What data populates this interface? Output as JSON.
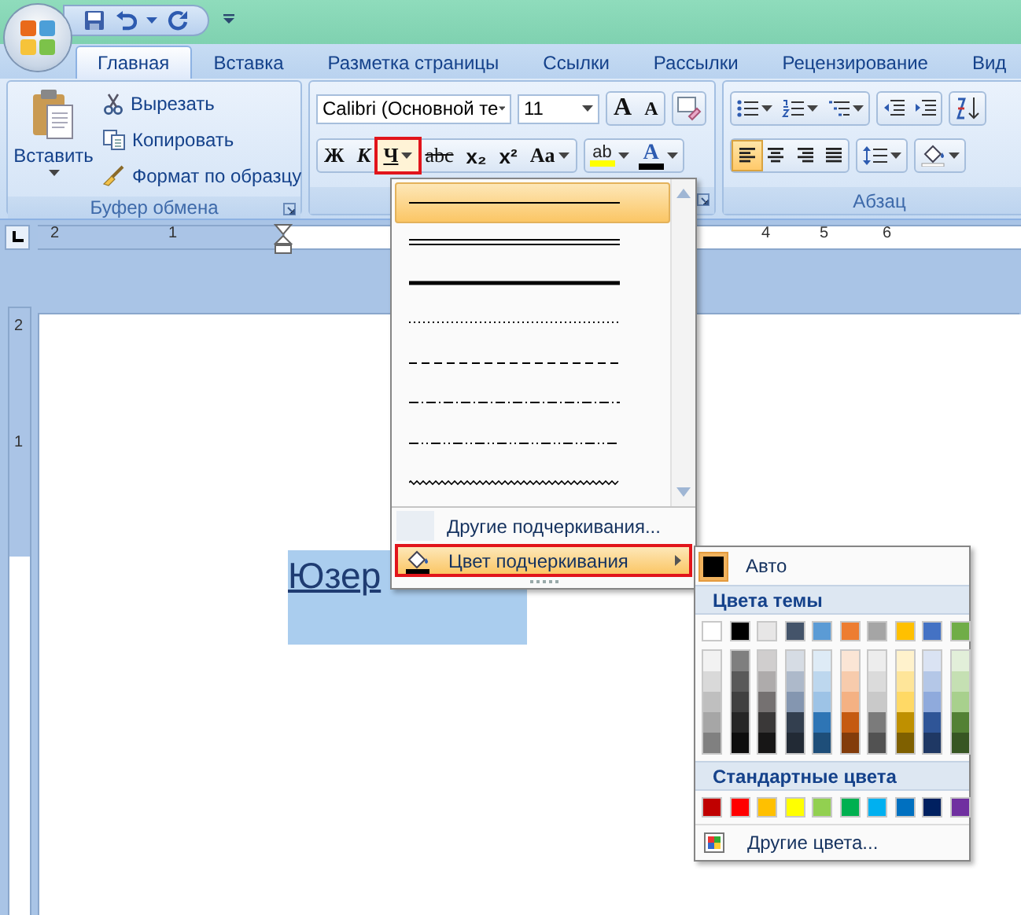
{
  "tabs": [
    {
      "label": "Главная",
      "selected": true
    },
    {
      "label": "Вставка",
      "selected": false
    },
    {
      "label": "Разметка страницы",
      "selected": false
    },
    {
      "label": "Ссылки",
      "selected": false
    },
    {
      "label": "Рассылки",
      "selected": false
    },
    {
      "label": "Рецензирование",
      "selected": false
    },
    {
      "label": "Вид",
      "selected": false
    }
  ],
  "clipboard": {
    "paste": "Вставить",
    "label": "Буфер обмена",
    "actions": [
      {
        "kind": "cut",
        "label": "Вырезать"
      },
      {
        "kind": "copy",
        "label": "Копировать"
      },
      {
        "kind": "format_painter",
        "label": "Формат по образцу"
      }
    ]
  },
  "font": {
    "name": "Calibri (Основной те",
    "size": "11",
    "grow": "A",
    "shrink": "A",
    "buttons": [
      {
        "kind": "bold",
        "label": "Ж",
        "annotated": false
      },
      {
        "kind": "italic",
        "label": "К",
        "annotated": false
      },
      {
        "kind": "underline",
        "label": "Ч",
        "annotated": true
      },
      {
        "kind": "strike",
        "label": "abc",
        "annotated": false
      },
      {
        "kind": "subscript",
        "label": "x₂",
        "annotated": false
      },
      {
        "kind": "superscript",
        "label": "x²",
        "annotated": false
      },
      {
        "kind": "case",
        "label": "Aa",
        "annotated": false
      }
    ],
    "highlight": {
      "label": "ab",
      "color": "#ffff00"
    },
    "font_color": {
      "label": "A",
      "color": "#000000"
    }
  },
  "paragraph": {
    "label": "Абзац",
    "align": [
      {
        "kind": "left",
        "selected": true
      },
      {
        "kind": "center",
        "selected": false
      },
      {
        "kind": "right",
        "selected": false
      },
      {
        "kind": "justify",
        "selected": false
      }
    ]
  },
  "ruler": {
    "labels": [
      "2",
      "1",
      "4",
      "5",
      "6"
    ],
    "vertical_labels": [
      "2",
      "1"
    ]
  },
  "document": {
    "text": "Юзер"
  },
  "underline_menu": {
    "styles": [
      {
        "kind": "single",
        "selected": true
      },
      {
        "kind": "double",
        "selected": false
      },
      {
        "kind": "thick",
        "selected": false
      },
      {
        "kind": "dotted",
        "selected": false
      },
      {
        "kind": "dashed",
        "selected": false
      },
      {
        "kind": "dash_dot",
        "selected": false
      },
      {
        "kind": "dash_dot_dot",
        "selected": false
      },
      {
        "kind": "wave",
        "selected": false
      }
    ],
    "more": "Другие подчеркивания...",
    "color_item": {
      "label": "Цвет подчеркивания",
      "selected": true,
      "annotated": true
    }
  },
  "color_menu": {
    "auto": {
      "label": "Авто",
      "color": "#000000"
    },
    "theme_title": "Цвета темы",
    "theme_colors": [
      {
        "color": "#ffffff",
        "shades": [
          {
            "color": "#f2f2f2"
          },
          {
            "color": "#d9d9d9"
          },
          {
            "color": "#bfbfbf"
          },
          {
            "color": "#a6a6a6"
          },
          {
            "color": "#808080"
          }
        ]
      },
      {
        "color": "#000000",
        "shades": [
          {
            "color": "#7f7f7f"
          },
          {
            "color": "#595959"
          },
          {
            "color": "#404040"
          },
          {
            "color": "#262626"
          },
          {
            "color": "#0d0d0d"
          }
        ]
      },
      {
        "color": "#e7e6e6",
        "shades": [
          {
            "color": "#d0cece"
          },
          {
            "color": "#aeabab"
          },
          {
            "color": "#757171"
          },
          {
            "color": "#3a3838"
          },
          {
            "color": "#171616"
          }
        ]
      },
      {
        "color": "#44546a",
        "shades": [
          {
            "color": "#d6dce4"
          },
          {
            "color": "#adb9ca"
          },
          {
            "color": "#8496b0"
          },
          {
            "color": "#333f4f"
          },
          {
            "color": "#222a35"
          }
        ]
      },
      {
        "color": "#5b9bd5",
        "shades": [
          {
            "color": "#deebf6"
          },
          {
            "color": "#bdd7ee"
          },
          {
            "color": "#9dc3e6"
          },
          {
            "color": "#2e75b5"
          },
          {
            "color": "#1e4e79"
          }
        ]
      },
      {
        "color": "#ed7d31",
        "shades": [
          {
            "color": "#fbe5d5"
          },
          {
            "color": "#f7cbac"
          },
          {
            "color": "#f4b183"
          },
          {
            "color": "#c55a11"
          },
          {
            "color": "#833c0b"
          }
        ]
      },
      {
        "color": "#a5a5a5",
        "shades": [
          {
            "color": "#ededed"
          },
          {
            "color": "#dbdbdb"
          },
          {
            "color": "#c9c9c9"
          },
          {
            "color": "#7b7b7b"
          },
          {
            "color": "#525252"
          }
        ]
      },
      {
        "color": "#ffc000",
        "shades": [
          {
            "color": "#fff2cc"
          },
          {
            "color": "#fee599"
          },
          {
            "color": "#ffd965"
          },
          {
            "color": "#bf9000"
          },
          {
            "color": "#7f6000"
          }
        ]
      },
      {
        "color": "#4472c4",
        "shades": [
          {
            "color": "#dae3f3"
          },
          {
            "color": "#b4c7e7"
          },
          {
            "color": "#8faadc"
          },
          {
            "color": "#2f5597"
          },
          {
            "color": "#1f3864"
          }
        ]
      },
      {
        "color": "#70ad47",
        "shades": [
          {
            "color": "#e2efd9"
          },
          {
            "color": "#c5e0b3"
          },
          {
            "color": "#a8d08d"
          },
          {
            "color": "#538135"
          },
          {
            "color": "#375623"
          }
        ]
      }
    ],
    "standard_title": "Стандартные цвета",
    "standard_colors": [
      {
        "color": "#c00000"
      },
      {
        "color": "#ff0000"
      },
      {
        "color": "#ffc000"
      },
      {
        "color": "#ffff00"
      },
      {
        "color": "#92d050"
      },
      {
        "color": "#00b050"
      },
      {
        "color": "#00b0f0"
      },
      {
        "color": "#0070c0"
      },
      {
        "color": "#002060"
      },
      {
        "color": "#7030a0"
      }
    ],
    "more": "Другие цвета..."
  }
}
